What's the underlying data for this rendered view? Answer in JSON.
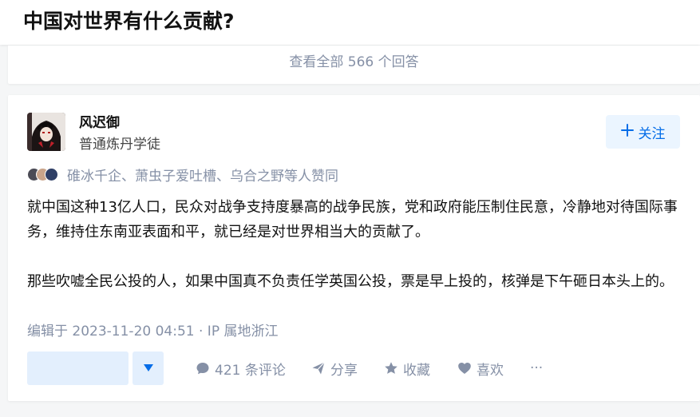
{
  "header": {
    "question_title": "中国对世界有什么贡献?"
  },
  "view_all": {
    "label": "查看全部 566 个回答"
  },
  "answer": {
    "author": {
      "name": "风迟御",
      "headline": "普通炼丹学徒",
      "avatar_icon": "anime-avatar"
    },
    "follow_button": {
      "label": "关注",
      "icon": "plus-icon"
    },
    "voters_text": "碓冰千企、萧虫子爱吐槽、乌合之野等人赞同",
    "paragraphs": [
      "就中国这种13亿人口，民众对战争支持度暴高的战争民族，党和政府能压制住民意，冷静地对待国际事务，维持住东南亚表面和平，就已经是对世界相当大的贡献了。",
      "那些吹嘘全民公投的人，如果中国真不负责任学英国公投，票是早上投的，核弹是下午砸日本头上的。"
    ],
    "edit_meta": "编辑于 2023-11-20 04:51 · IP 属地浙江",
    "actions": {
      "comments": "421 条评论",
      "share": "分享",
      "collect": "收藏",
      "like": "喜欢",
      "more": "···"
    }
  },
  "colors": {
    "accent": "#056de8",
    "accent_bg": "#ebf5ff",
    "meta": "#8590a6",
    "page_bg": "#f5f6f7"
  }
}
